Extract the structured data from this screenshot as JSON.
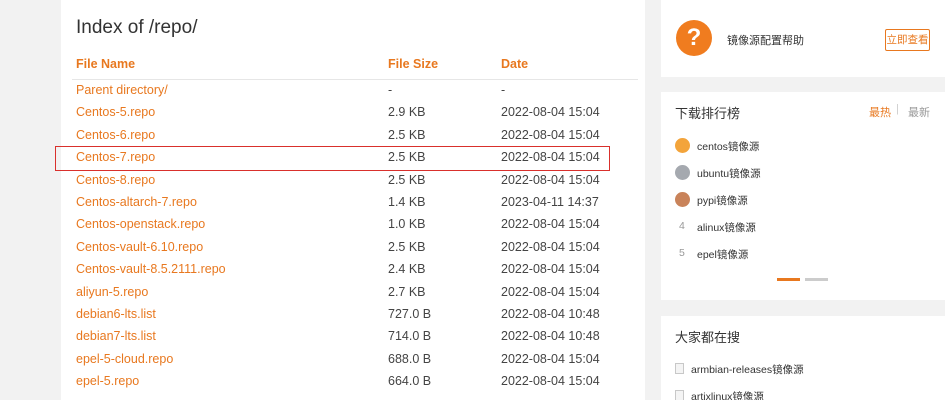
{
  "listing": {
    "title": "Index of /repo/",
    "columns": {
      "name": "File Name",
      "size": "File Size",
      "date": "Date"
    },
    "rows": [
      {
        "name": "Parent directory/",
        "size": "-",
        "date": "-"
      },
      {
        "name": "Centos-5.repo",
        "size": "2.9 KB",
        "date": "2022-08-04 15:04"
      },
      {
        "name": "Centos-6.repo",
        "size": "2.5 KB",
        "date": "2022-08-04 15:04"
      },
      {
        "name": "Centos-7.repo",
        "size": "2.5 KB",
        "date": "2022-08-04 15:04"
      },
      {
        "name": "Centos-8.repo",
        "size": "2.5 KB",
        "date": "2022-08-04 15:04"
      },
      {
        "name": "Centos-altarch-7.repo",
        "size": "1.4 KB",
        "date": "2023-04-11 14:37"
      },
      {
        "name": "Centos-openstack.repo",
        "size": "1.0 KB",
        "date": "2022-08-04 15:04"
      },
      {
        "name": "Centos-vault-6.10.repo",
        "size": "2.5 KB",
        "date": "2022-08-04 15:04"
      },
      {
        "name": "Centos-vault-8.5.2111.repo",
        "size": "2.4 KB",
        "date": "2022-08-04 15:04"
      },
      {
        "name": "aliyun-5.repo",
        "size": "2.7 KB",
        "date": "2022-08-04 15:04"
      },
      {
        "name": "debian6-lts.list",
        "size": "727.0 B",
        "date": "2022-08-04 10:48"
      },
      {
        "name": "debian7-lts.list",
        "size": "714.0 B",
        "date": "2022-08-04 10:48"
      },
      {
        "name": "epel-5-cloud.repo",
        "size": "688.0 B",
        "date": "2022-08-04 15:04"
      },
      {
        "name": "epel-5.repo",
        "size": "664.0 B",
        "date": "2022-08-04 15:04"
      }
    ],
    "highlighted_row": "Centos-7.repo"
  },
  "help": {
    "icon": "question-icon",
    "icon_glyph": "?",
    "label": "镜像源配置帮助",
    "button": "立即查看"
  },
  "ranking": {
    "title": "下载排行榜",
    "tab_active": "最热",
    "separator": "|",
    "tab_inactive": "最新",
    "items": [
      {
        "medal": "gold",
        "label": "centos镜像源"
      },
      {
        "medal": "silver",
        "label": "ubuntu镜像源"
      },
      {
        "medal": "bronze",
        "label": "pypi镜像源"
      },
      {
        "num": "4",
        "label": "alinux镜像源"
      },
      {
        "num": "5",
        "label": "epel镜像源"
      }
    ]
  },
  "search": {
    "title": "大家都在搜",
    "items": [
      {
        "label": "armbian-releases镜像源"
      },
      {
        "label": "artixlinux镜像源"
      }
    ]
  },
  "colors": {
    "accent": "#e8781f",
    "highlight_border": "#d9302c"
  }
}
